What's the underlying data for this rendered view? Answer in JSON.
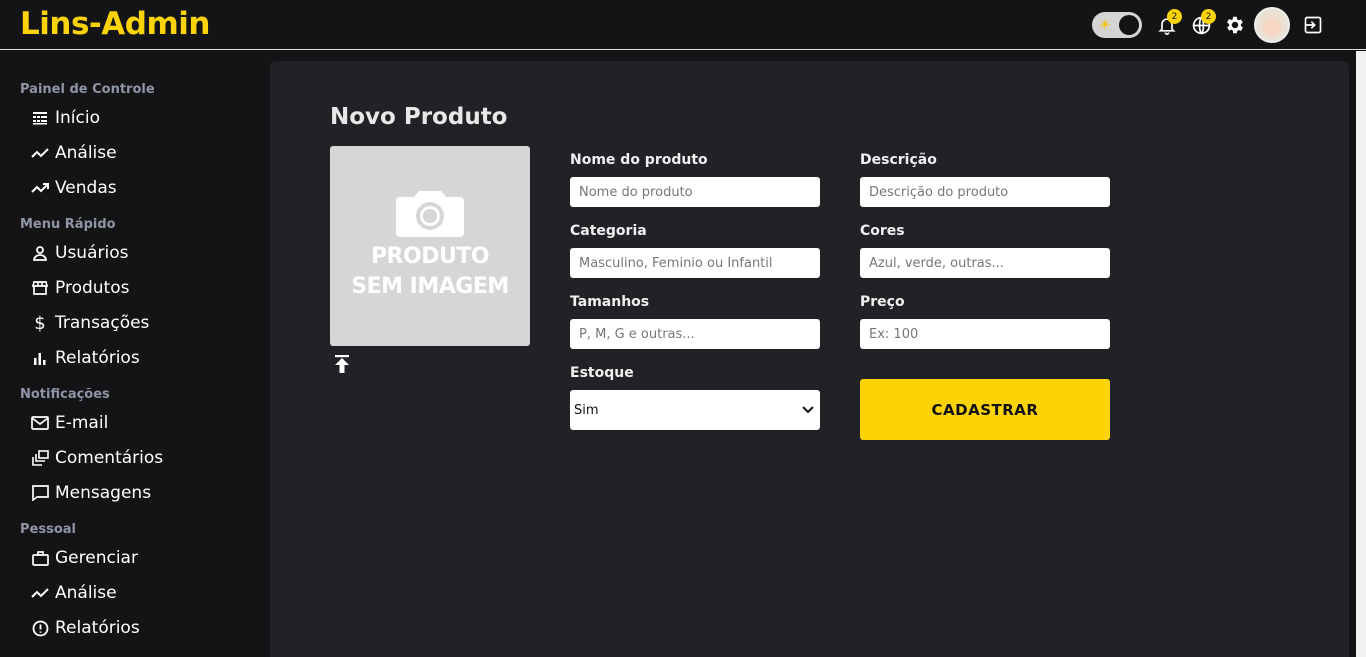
{
  "header": {
    "logo": "Lins-Admin",
    "notifications_badge": "2",
    "language_badge": "2"
  },
  "sidebar": {
    "sections": [
      {
        "title": "Painel de Controle",
        "items": [
          {
            "label": "Início",
            "icon": "dashboard-icon"
          },
          {
            "label": "Análise",
            "icon": "trending-line-icon"
          },
          {
            "label": "Vendas",
            "icon": "trending-up-icon"
          }
        ]
      },
      {
        "title": "Menu Rápido",
        "items": [
          {
            "label": "Usuários",
            "icon": "user-icon"
          },
          {
            "label": "Produtos",
            "icon": "storefront-icon"
          },
          {
            "label": "Transações",
            "icon": "dollar-icon"
          },
          {
            "label": "Relatórios",
            "icon": "bar-chart-icon"
          }
        ]
      },
      {
        "title": "Notificações",
        "items": [
          {
            "label": "E-mail",
            "icon": "mail-icon"
          },
          {
            "label": "Comentários",
            "icon": "dynamic-feed-icon"
          },
          {
            "label": "Mensagens",
            "icon": "chat-bubble-icon"
          }
        ]
      },
      {
        "title": "Pessoal",
        "items": [
          {
            "label": "Gerenciar",
            "icon": "briefcase-icon"
          },
          {
            "label": "Análise",
            "icon": "trending-line-icon"
          },
          {
            "label": "Relatórios",
            "icon": "report-icon"
          }
        ]
      }
    ]
  },
  "main": {
    "title": "Novo Produto",
    "image_placeholder": {
      "line1": "PRODUTO",
      "line2": "SEM IMAGEM"
    },
    "fields": {
      "name": {
        "label": "Nome do produto",
        "placeholder": "Nome do produto"
      },
      "description": {
        "label": "Descrição",
        "placeholder": "Descrição do produto"
      },
      "category": {
        "label": "Categoria",
        "placeholder": "Masculino, Feminio ou Infantil"
      },
      "colors": {
        "label": "Cores",
        "placeholder": "Azul, verde, outras..."
      },
      "sizes": {
        "label": "Tamanhos",
        "placeholder": "P, M, G e outras..."
      },
      "price": {
        "label": "Preço",
        "placeholder": "Ex: 100"
      },
      "stock": {
        "label": "Estoque",
        "selected": "Sim"
      }
    },
    "submit_label": "CADASTRAR"
  },
  "colors": {
    "accent": "#fcd307",
    "panel": "#202226",
    "background": "#141416"
  }
}
